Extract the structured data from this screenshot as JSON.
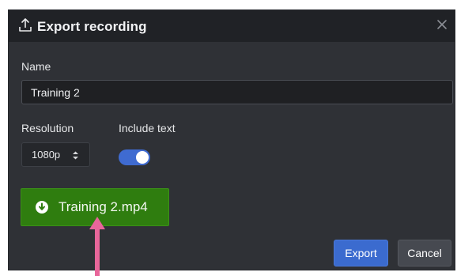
{
  "dialog": {
    "title": "Export recording",
    "icons": {
      "title": "upload-icon",
      "close": "close-icon",
      "download": "download-circle-icon",
      "select_arrows": "up-down-chevron-icon"
    }
  },
  "form": {
    "name_label": "Name",
    "name_value": "Training 2",
    "resolution_label": "Resolution",
    "resolution_value": "1080p",
    "include_text_label": "Include text",
    "include_text_enabled": true
  },
  "download": {
    "label": "Training 2.mp4"
  },
  "buttons": {
    "export_label": "Export",
    "cancel_label": "Cancel"
  },
  "colors": {
    "dialog_bg": "#2f3136",
    "titlebar_bg": "#202226",
    "accent_blue": "#3b6bcf",
    "download_green": "#2f7d0f",
    "annotation_pink": "#e8669a"
  }
}
